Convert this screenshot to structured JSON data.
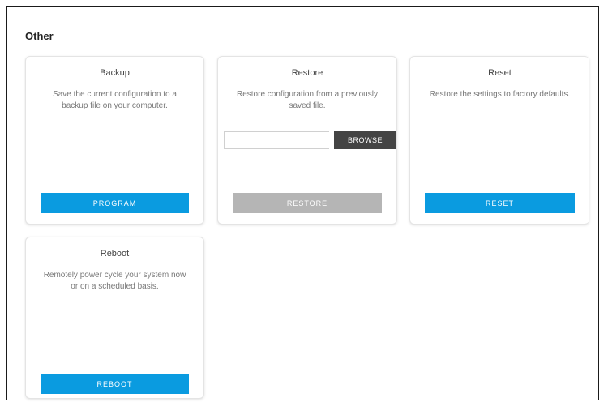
{
  "section": {
    "title": "Other"
  },
  "cards": {
    "backup": {
      "title": "Backup",
      "description": "Save the current configuration to a backup file on your computer.",
      "button": "PROGRAM"
    },
    "restore": {
      "title": "Restore",
      "description": "Restore configuration from a previously saved file.",
      "file_value": "",
      "browse_label": "BROWSE",
      "button": "RESTORE"
    },
    "reset": {
      "title": "Reset",
      "description": "Restore the settings to factory defaults.",
      "button": "RESET"
    },
    "reboot": {
      "title": "Reboot",
      "description": "Remotely power cycle your system now or on a scheduled basis.",
      "button": "REBOOT"
    }
  },
  "colors": {
    "accent": "#0a9be0",
    "disabled": "#b5b5b5",
    "browse": "#444444"
  }
}
